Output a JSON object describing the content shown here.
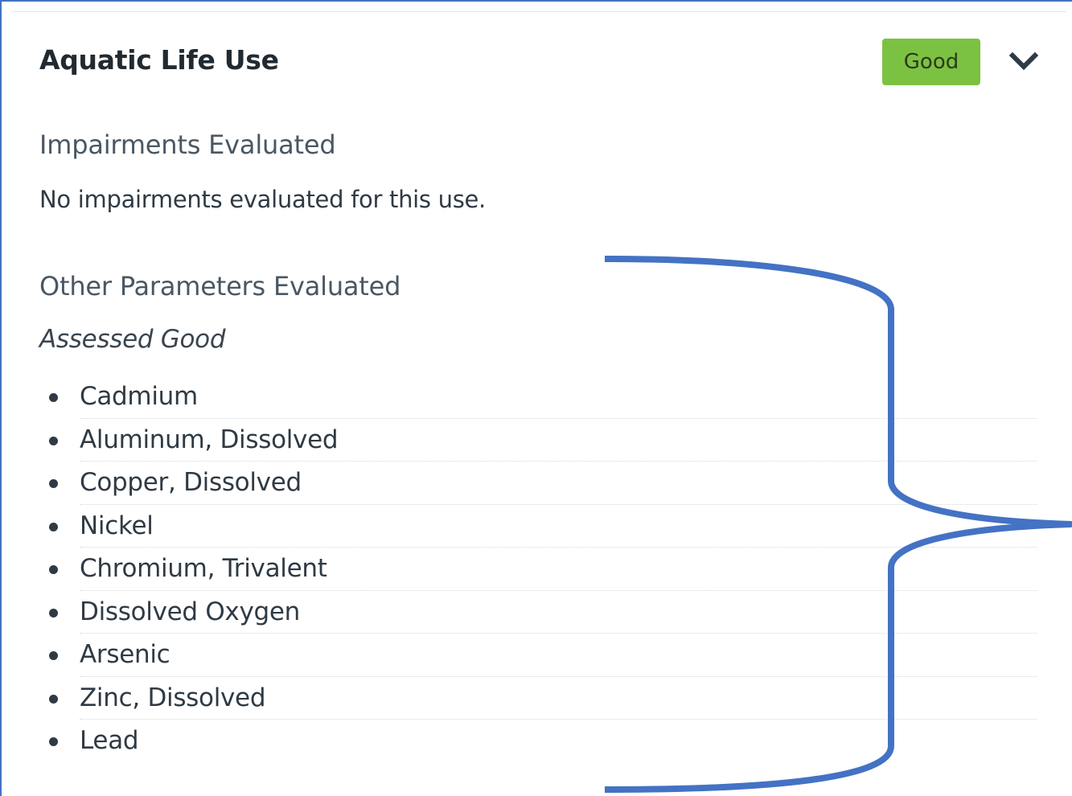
{
  "card": {
    "title": "Aquatic Life Use",
    "status_badge": "Good",
    "status_color": "#7cc242"
  },
  "impairments": {
    "heading": "Impairments Evaluated",
    "message": "No impairments evaluated for this use."
  },
  "other_parameters": {
    "heading": "Other Parameters Evaluated",
    "subheading": "Assessed Good",
    "items": [
      "Cadmium",
      "Aluminum, Dissolved",
      "Copper, Dissolved",
      "Nickel",
      "Chromium, Trivalent",
      "Dissolved Oxygen",
      "Arsenic",
      "Zinc, Dissolved",
      "Lead"
    ]
  },
  "icons": {
    "expand": "chevron-down-icon",
    "list_marker": "bullet-icon"
  },
  "annotation_color": "#4472c4"
}
